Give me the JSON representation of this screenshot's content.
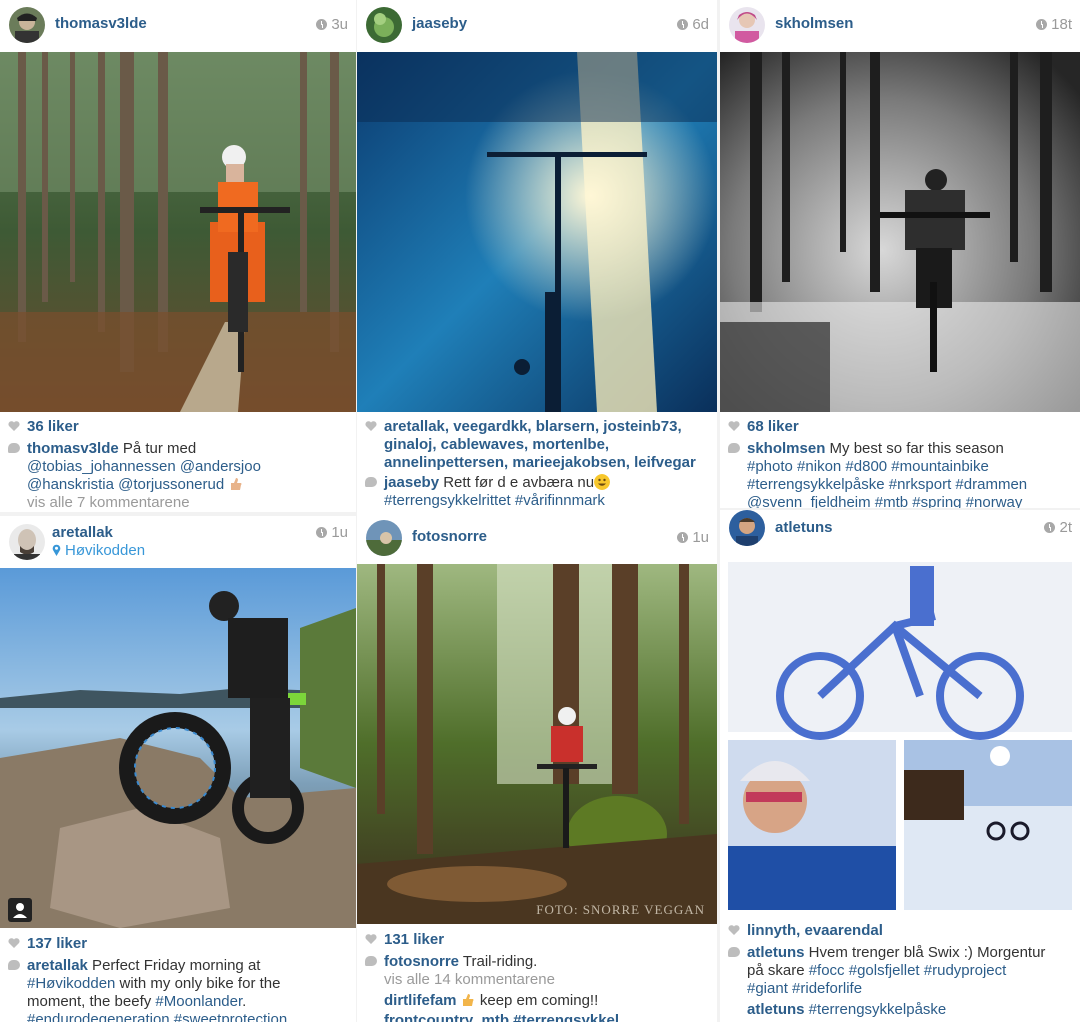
{
  "posts": [
    {
      "user": "thomasv3lde",
      "time": "3u",
      "likes": "36 liker",
      "caption_user": "thomasv3lde",
      "caption_text": " På tur med",
      "mentions_line1": "@tobias_johannessen @andersjoo",
      "mentions_line2": "@hanskristia @torjussonerud",
      "more": "vis alle 7 kommentarene"
    },
    {
      "user": "jaaseby",
      "time": "6d",
      "likers_line1": "aretallak, veegardkk, blarsern, josteinb73,",
      "likers_line2": "ginaloj, cablewaves, mortenlbe,",
      "likers_line3": "annelinpettersen, marieejakobsen, leifvegar",
      "caption_user": "jaaseby",
      "caption_text": " Rett før d e avbæra nu",
      "hashtags": "#terrengsykkelrittet #vårifinnmark"
    },
    {
      "user": "skholmsen",
      "time": "18t",
      "likes": "68 liker",
      "caption_user": "skholmsen",
      "caption_text": " My best so far this season",
      "tags_line1": "#photo #nikon #d800 #mountainbike",
      "tags_line2": "#terrengsykkelpåske #nrksport #drammen",
      "tags_line3": "@svenn_fjeldheim #mtb #spring #norway"
    },
    {
      "user": "aretallak",
      "location": "Høvikodden",
      "time": "1u",
      "likes": "137 liker",
      "caption_user": "aretallak",
      "caption_text": " Perfect Friday morning at",
      "caption_line2_tag": "#Høvikodden",
      "caption_line2_text": " with my only bike for the",
      "caption_line3_text": "moment, the beefy ",
      "caption_line3_tag": "#Moonlander",
      "caption_line3_end": ".",
      "caption_line4": "#endurodegeneration #sweetprotection"
    },
    {
      "user": "fotosnorre",
      "time": "1u",
      "likes": "131 liker",
      "caption_user": "fotosnorre",
      "caption_text": " Trail-riding.",
      "more": "vis alle 14 kommentarene",
      "comment_user": "dirtlifefam",
      "comment_text": " keep em coming!!",
      "watermark": "FOTO: SNORRE VEGGAN",
      "next_comment": "frontcountry_mtb #terrengsykkel"
    },
    {
      "user": "atletuns",
      "time": "2t",
      "likers": "linnyth, evaarendal",
      "caption_user": "atletuns",
      "caption_text": " Hvem trenger blå Swix :) Morgentur",
      "caption_line2_text": "på skare ",
      "caption_line2_tags": "#focc #golsfjellet #rudyproject",
      "caption_line3_tags": "#giant #rideforlife",
      "comment_user": "atletuns",
      "comment_text": " #terrengsykkelpåske"
    }
  ],
  "colors": {
    "username": "#2c5d8a",
    "location": "#3897d8",
    "meta": "#9a9a9a"
  }
}
